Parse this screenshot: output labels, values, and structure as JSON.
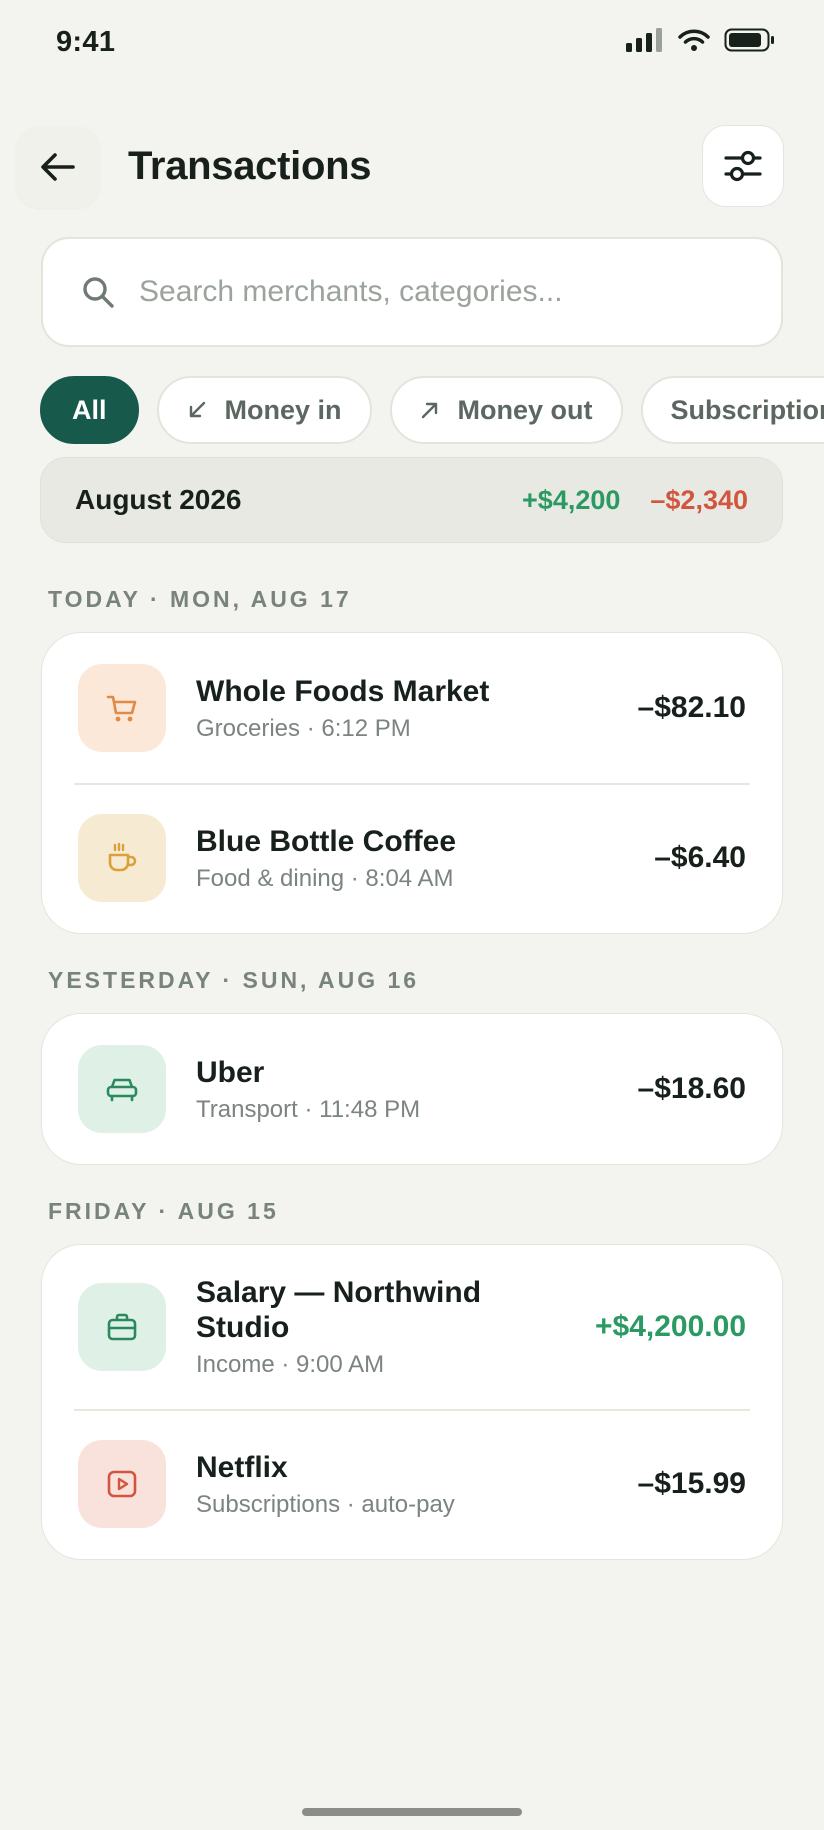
{
  "status_bar": {
    "time": "9:41"
  },
  "header": {
    "title": "Transactions"
  },
  "search": {
    "placeholder": "Search merchants, categories..."
  },
  "filters": [
    {
      "label": "All",
      "active": true
    },
    {
      "label": "Money in",
      "icon": "arrow-down-left-icon"
    },
    {
      "label": "Money out",
      "icon": "arrow-up-right-icon"
    },
    {
      "label": "Subscriptions"
    }
  ],
  "summary": {
    "month": "August 2026",
    "money_in": "+$4,200",
    "money_out": "–$2,340"
  },
  "groups": [
    {
      "label": "TODAY · MON, AUG 17",
      "items": [
        {
          "name": "Whole Foods Market",
          "sub": "Groceries · 6:12 PM",
          "amount": "–$82.10",
          "icon": "cart-icon"
        },
        {
          "name": "Blue Bottle Coffee",
          "sub": "Food & dining · 8:04 AM",
          "amount": "–$6.40",
          "icon": "coffee-cup-icon"
        }
      ]
    },
    {
      "label": "YESTERDAY · SUN, AUG 16",
      "items": [
        {
          "name": "Uber",
          "sub": "Transport · 11:48 PM",
          "amount": "–$18.60",
          "icon": "car-icon"
        }
      ]
    },
    {
      "label": "FRIDAY · AUG 15",
      "items": [
        {
          "name": "Salary — Northwind Studio",
          "sub": "Income · 9:00 AM",
          "amount": "+$4,200.00",
          "icon": "briefcase-icon"
        },
        {
          "name": "Netflix",
          "sub": "Subscriptions · auto-pay",
          "amount": "–$15.99",
          "icon": "play-icon"
        }
      ]
    }
  ],
  "colors": {
    "accent": "#17594a",
    "positive": "#2a9a62",
    "negative": "#d2563f",
    "background": "#f3f3ef"
  }
}
